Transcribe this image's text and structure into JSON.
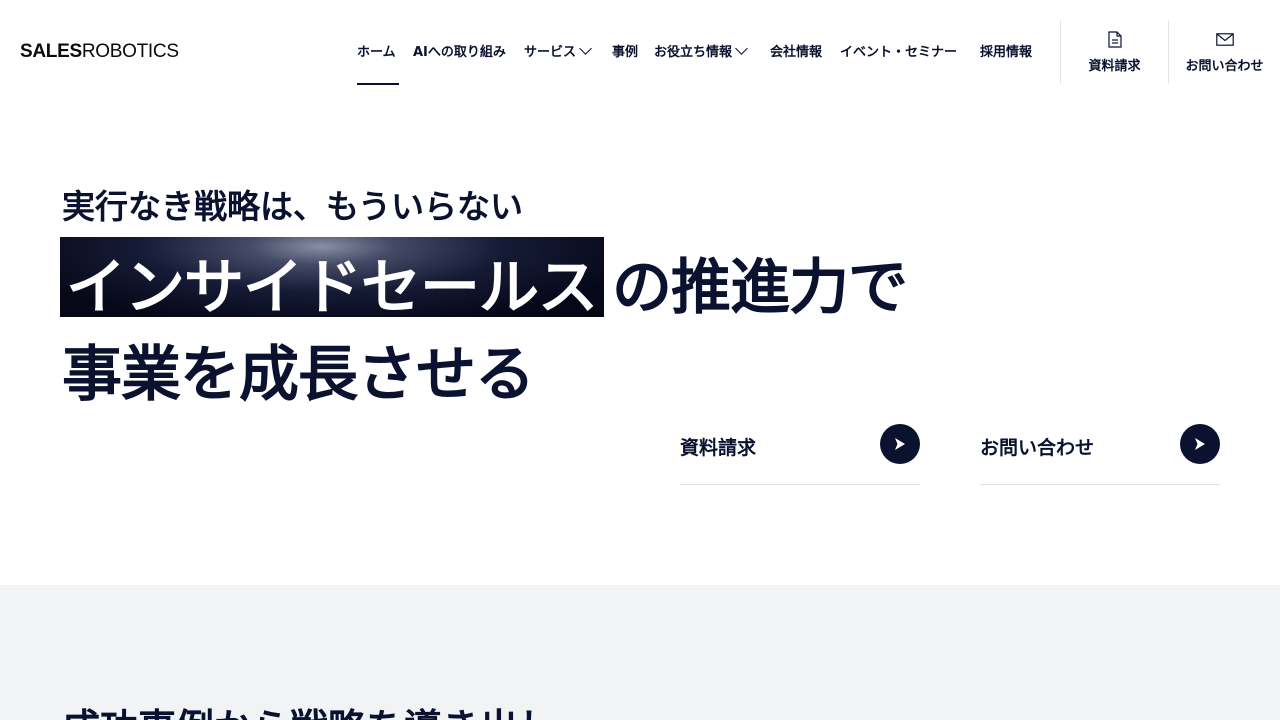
{
  "brand": {
    "logo_bold": "SALES",
    "logo_light": "ROBOTICS"
  },
  "nav": {
    "items": [
      {
        "label": "ホーム",
        "active": true
      },
      {
        "label": "AIへの取り組み"
      },
      {
        "label": "サービス",
        "dropdown": true
      },
      {
        "label": "事例"
      },
      {
        "label": "お役立ち情報",
        "dropdown": true
      },
      {
        "label": "会社情報"
      },
      {
        "label": "イベント・セミナー"
      },
      {
        "label": "採用情報"
      }
    ]
  },
  "header_actions": {
    "document": {
      "label": "資料請求",
      "icon": "document-icon"
    },
    "contact": {
      "label": "お問い合わせ",
      "icon": "mail-icon"
    }
  },
  "hero": {
    "subtitle": "実行なき戦略は、もういらない",
    "highlight": "インサイドセールス",
    "line1_rest": "の推進力で",
    "line2": "事業を成長させる",
    "cta": [
      {
        "label": "資料請求",
        "icon": "arrow-right-icon"
      },
      {
        "label": "お問い合わせ",
        "icon": "arrow-right-icon"
      }
    ]
  },
  "section2": {
    "title": "成功事例から戦略を導き出し"
  },
  "colors": {
    "navy": "#0b1230",
    "background_light": "#f2f3f5",
    "divider": "#dfe2e8"
  }
}
